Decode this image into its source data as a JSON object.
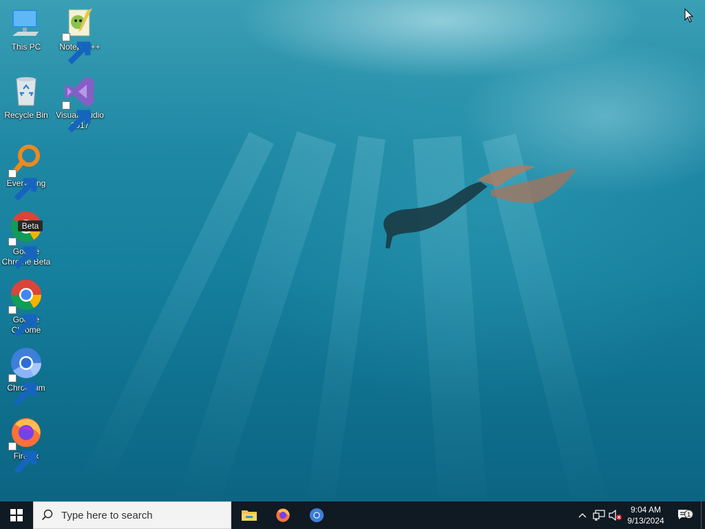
{
  "desktop": {
    "icons": [
      {
        "label": "This PC",
        "icon": "computer-icon"
      },
      {
        "label": "Notepad++",
        "icon": "notepadpp-icon"
      },
      {
        "label": "Recycle Bin",
        "icon": "recycle-bin-icon"
      },
      {
        "label": "Visual Studio 2017",
        "icon": "visual-studio-icon"
      },
      {
        "label": "Everything",
        "icon": "everything-search-icon"
      },
      {
        "label": "Google Chrome Beta",
        "icon": "chrome-beta-icon",
        "badge": "Beta"
      },
      {
        "label": "Google Chrome",
        "icon": "chrome-icon"
      },
      {
        "label": "Chromium",
        "icon": "chromium-icon"
      },
      {
        "label": "Firefox",
        "icon": "firefox-icon"
      }
    ]
  },
  "taskbar": {
    "search_placeholder": "Type here to search",
    "pinned": [
      {
        "name": "File Explorer",
        "icon": "file-explorer-icon"
      },
      {
        "name": "Firefox",
        "icon": "firefox-icon"
      },
      {
        "name": "Chromium",
        "icon": "chromium-icon"
      }
    ],
    "tray": {
      "time": "9:04 AM",
      "date": "9/13/2024",
      "notification_count": "1"
    }
  },
  "colors": {
    "taskbar": "#101a22",
    "water_top": "#3a9fb5",
    "water_bottom": "#0b6583",
    "windows_logo": "#ffffff"
  }
}
